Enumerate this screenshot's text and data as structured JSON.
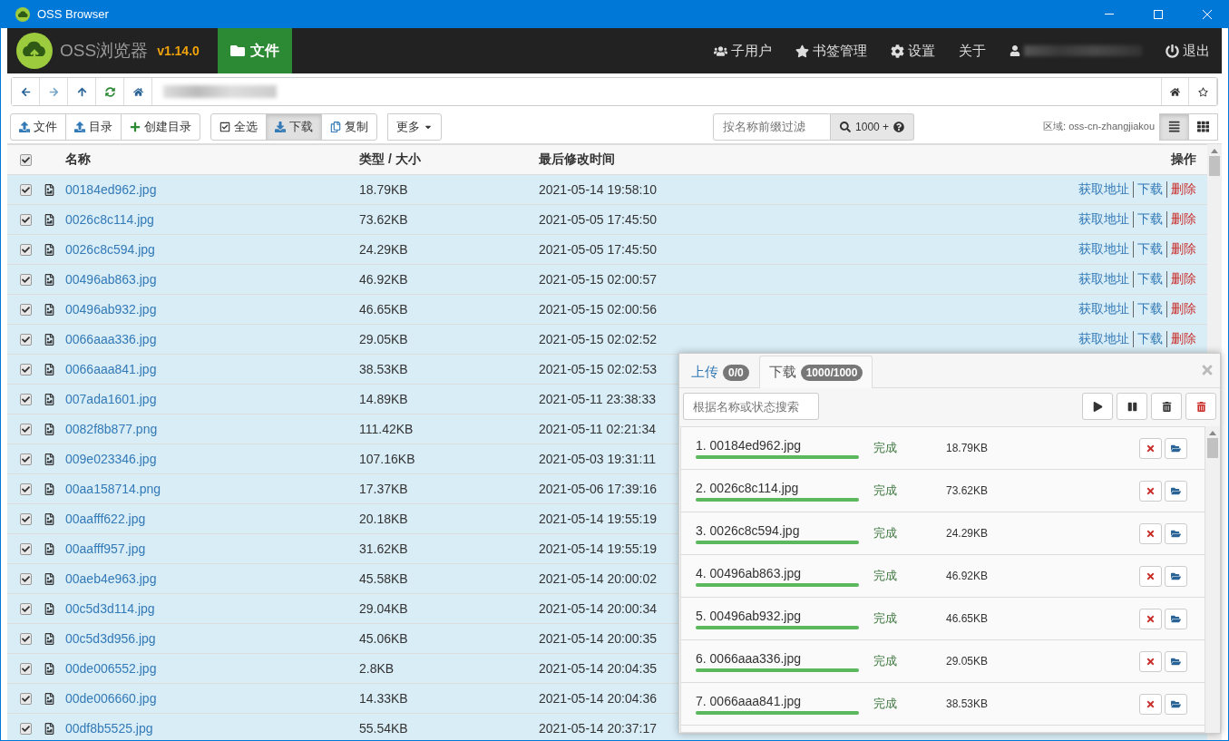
{
  "window": {
    "title": "OSS Browser"
  },
  "navbar": {
    "brand": "OSS浏览器",
    "version": "v1.14.0",
    "tabs": [
      {
        "label": "文件",
        "selected": true
      }
    ],
    "menu": [
      {
        "label": "子用户",
        "kind": "users"
      },
      {
        "label": "书签管理",
        "kind": "star"
      },
      {
        "label": "设置",
        "kind": "gear"
      },
      {
        "label": "关于",
        "kind": "plain"
      },
      {
        "kind": "redacted-user"
      },
      {
        "label": "退出",
        "kind": "power"
      }
    ]
  },
  "toolbar": {
    "groups": [
      [
        {
          "label": "文件",
          "kind": "upload",
          "pressed": false
        },
        {
          "label": "目录",
          "kind": "upload",
          "pressed": false
        },
        {
          "label": "创建目录",
          "kind": "plus",
          "pressed": false
        }
      ],
      [
        {
          "label": "全选",
          "kind": "check",
          "pressed": false
        },
        {
          "label": "下载",
          "kind": "download",
          "pressed": true
        },
        {
          "label": "复制",
          "kind": "copy",
          "pressed": false
        }
      ],
      [
        {
          "label": "更多",
          "kind": "dropdown",
          "pressed": false
        }
      ]
    ],
    "filter_placeholder": "按名称前缀过滤",
    "count": "1000 +",
    "region": "区域: oss-cn-zhangjiakou",
    "view_buttons": [
      {
        "kind": "list",
        "selected": true
      },
      {
        "kind": "grid",
        "selected": false
      }
    ]
  },
  "table": {
    "columns": [
      "名称",
      "类型 / 大小",
      "最后修改时间",
      "操作"
    ],
    "all_checked": true,
    "rows": [
      {
        "name": "00184ed962.jpg",
        "size": "18.79KB",
        "modified": "2021-05-14 19:58:10",
        "checked": true,
        "actions": [
          {
            "label": "获取地址",
            "kind": "link"
          },
          {
            "label": "下载",
            "kind": "link"
          },
          {
            "label": "删除",
            "kind": "danger"
          }
        ]
      },
      {
        "name": "0026c8c114.jpg",
        "size": "73.62KB",
        "modified": "2021-05-05 17:45:50",
        "checked": true,
        "actions": [
          {
            "label": "获取地址",
            "kind": "link"
          },
          {
            "label": "下载",
            "kind": "link"
          },
          {
            "label": "删除",
            "kind": "danger"
          }
        ]
      },
      {
        "name": "0026c8c594.jpg",
        "size": "24.29KB",
        "modified": "2021-05-05 17:45:50",
        "checked": true,
        "actions": [
          {
            "label": "获取地址",
            "kind": "link"
          },
          {
            "label": "下载",
            "kind": "link"
          },
          {
            "label": "删除",
            "kind": "danger"
          }
        ]
      },
      {
        "name": "00496ab863.jpg",
        "size": "46.92KB",
        "modified": "2021-05-15 02:00:57",
        "checked": true,
        "actions": [
          {
            "label": "获取地址",
            "kind": "link"
          },
          {
            "label": "下载",
            "kind": "link"
          },
          {
            "label": "删除",
            "kind": "danger"
          }
        ]
      },
      {
        "name": "00496ab932.jpg",
        "size": "46.65KB",
        "modified": "2021-05-15 02:00:56",
        "checked": true,
        "actions": [
          {
            "label": "获取地址",
            "kind": "link"
          },
          {
            "label": "下载",
            "kind": "link"
          },
          {
            "label": "删除",
            "kind": "danger"
          }
        ]
      },
      {
        "name": "0066aaa336.jpg",
        "size": "29.05KB",
        "modified": "2021-05-15 02:02:52",
        "checked": true,
        "actions": [
          {
            "label": "获取地址",
            "kind": "link"
          },
          {
            "label": "下载",
            "kind": "link"
          },
          {
            "label": "删除",
            "kind": "danger"
          }
        ]
      },
      {
        "name": "0066aaa841.jpg",
        "size": "38.53KB",
        "modified": "2021-05-15 02:02:53",
        "checked": true
      },
      {
        "name": "007ada1601.jpg",
        "size": "14.89KB",
        "modified": "2021-05-11 23:38:33",
        "checked": true
      },
      {
        "name": "0082f8b877.png",
        "size": "111.42KB",
        "modified": "2021-05-11 02:21:34",
        "checked": true
      },
      {
        "name": "009e023346.jpg",
        "size": "107.16KB",
        "modified": "2021-05-03 19:31:11",
        "checked": true
      },
      {
        "name": "00aa158714.png",
        "size": "17.37KB",
        "modified": "2021-05-06 17:39:16",
        "checked": true
      },
      {
        "name": "00aafff622.jpg",
        "size": "20.18KB",
        "modified": "2021-05-14 19:55:19",
        "checked": true
      },
      {
        "name": "00aafff957.jpg",
        "size": "31.62KB",
        "modified": "2021-05-14 19:55:19",
        "checked": true
      },
      {
        "name": "00aeb4e963.jpg",
        "size": "45.58KB",
        "modified": "2021-05-14 20:00:02",
        "checked": true
      },
      {
        "name": "00c5d3d114.jpg",
        "size": "29.04KB",
        "modified": "2021-05-14 20:00:34",
        "checked": true
      },
      {
        "name": "00c5d3d956.jpg",
        "size": "45.06KB",
        "modified": "2021-05-14 20:00:35",
        "checked": true
      },
      {
        "name": "00de006552.jpg",
        "size": "2.8KB",
        "modified": "2021-05-14 20:04:35",
        "checked": true
      },
      {
        "name": "00de006660.jpg",
        "size": "14.33KB",
        "modified": "2021-05-14 20:04:36",
        "checked": true
      },
      {
        "name": "00df8b5525.jpg",
        "size": "55.54KB",
        "modified": "2021-05-14 20:37:17",
        "checked": true
      }
    ]
  },
  "transfer_panel": {
    "tabs": [
      {
        "label": "上传",
        "badge": "0/0",
        "selected": false
      },
      {
        "label": "下载",
        "badge": "1000/1000",
        "selected": true
      }
    ],
    "search_placeholder": "根据名称或状态搜索",
    "items": [
      {
        "name": "1. 00184ed962.jpg",
        "status": "完成",
        "size": "18.79KB",
        "level": 1
      },
      {
        "name": "2. 0026c8c114.jpg",
        "status": "完成",
        "size": "73.62KB",
        "level": 1
      },
      {
        "name": "3. 0026c8c594.jpg",
        "status": "完成",
        "size": "24.29KB",
        "level": 1
      },
      {
        "name": "4. 00496ab863.jpg",
        "status": "完成",
        "size": "46.92KB",
        "level": 1
      },
      {
        "name": "5. 00496ab932.jpg",
        "status": "完成",
        "size": "46.65KB",
        "level": 1
      },
      {
        "name": "6. 0066aaa336.jpg",
        "status": "完成",
        "size": "29.05KB",
        "level": 1
      },
      {
        "name": "7. 0066aaa841.jpg",
        "status": "完成",
        "size": "38.53KB",
        "level": 1
      }
    ]
  }
}
